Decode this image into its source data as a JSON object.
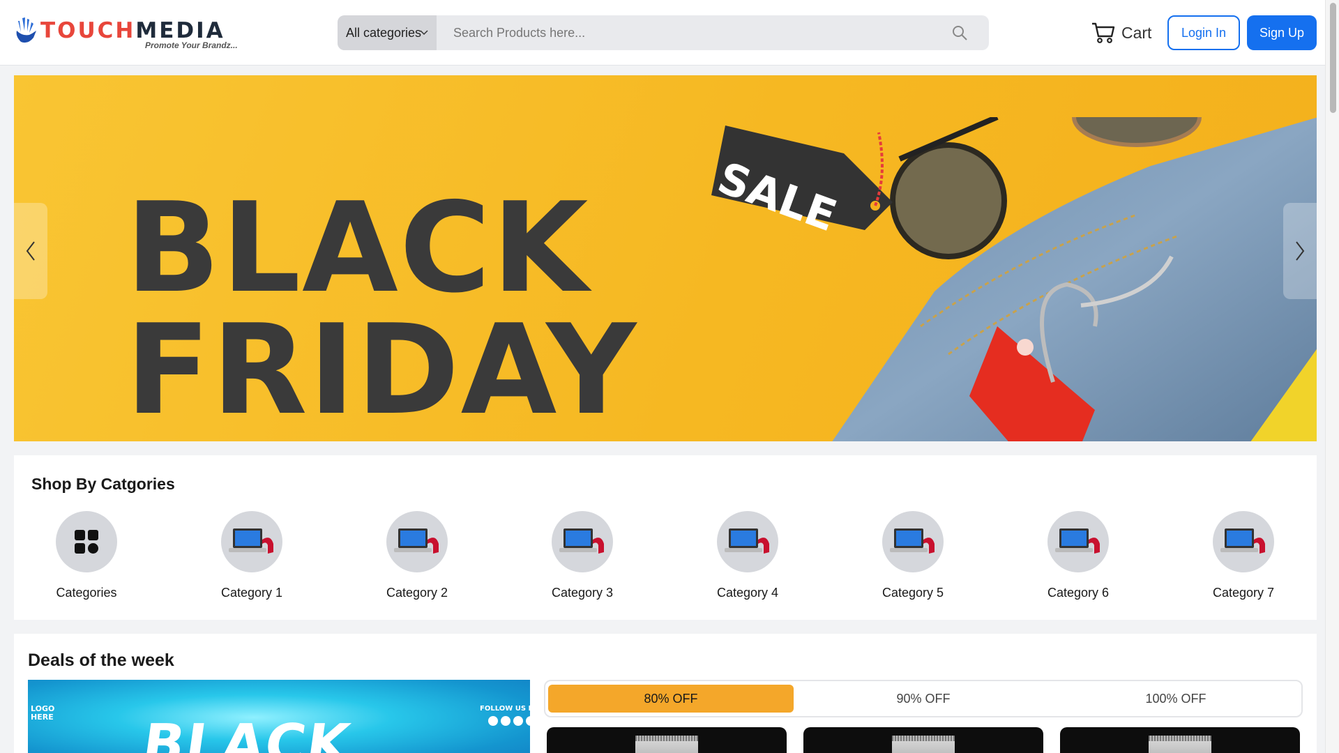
{
  "header": {
    "logo": {
      "brand_part1": "TOUCH",
      "brand_part2": "MEDIA",
      "tagline": "Promote Your Brandz..."
    },
    "search": {
      "category_label": "All categories",
      "placeholder": "Search Products here...",
      "value": ""
    },
    "cart_label": "Cart",
    "login_label": "Login In",
    "signup_label": "Sign Up"
  },
  "hero": {
    "headline_line1": "BLACK",
    "headline_line2": "FRIDAY",
    "tag_text": "SALE"
  },
  "categories": {
    "heading": "Shop By Catgories",
    "items": [
      {
        "label": "Categories",
        "icon": "grid-icon"
      },
      {
        "label": "Category 1",
        "icon": "laptop-headphones-icon"
      },
      {
        "label": "Category 2",
        "icon": "laptop-headphones-icon"
      },
      {
        "label": "Category 3",
        "icon": "laptop-headphones-icon"
      },
      {
        "label": "Category 4",
        "icon": "laptop-headphones-icon"
      },
      {
        "label": "Category 5",
        "icon": "laptop-headphones-icon"
      },
      {
        "label": "Category 6",
        "icon": "laptop-headphones-icon"
      },
      {
        "label": "Category 7",
        "icon": "laptop-headphones-icon"
      }
    ]
  },
  "deals": {
    "heading": "Deals of the week",
    "promo": {
      "logo_line1": "LOGO",
      "logo_line2": "HERE",
      "follow_text": "FOLLOW US NOW",
      "big_text": "BLACK"
    },
    "tabs": [
      {
        "label": "80% OFF",
        "active": true
      },
      {
        "label": "90% OFF",
        "active": false
      },
      {
        "label": "100% OFF",
        "active": false
      }
    ]
  },
  "colors": {
    "primary": "#1570ef",
    "accent_tab": "#f4a72a",
    "hero_bg": "#f6b822",
    "logo_red": "#e8463b",
    "logo_dark": "#1f2b3b"
  }
}
